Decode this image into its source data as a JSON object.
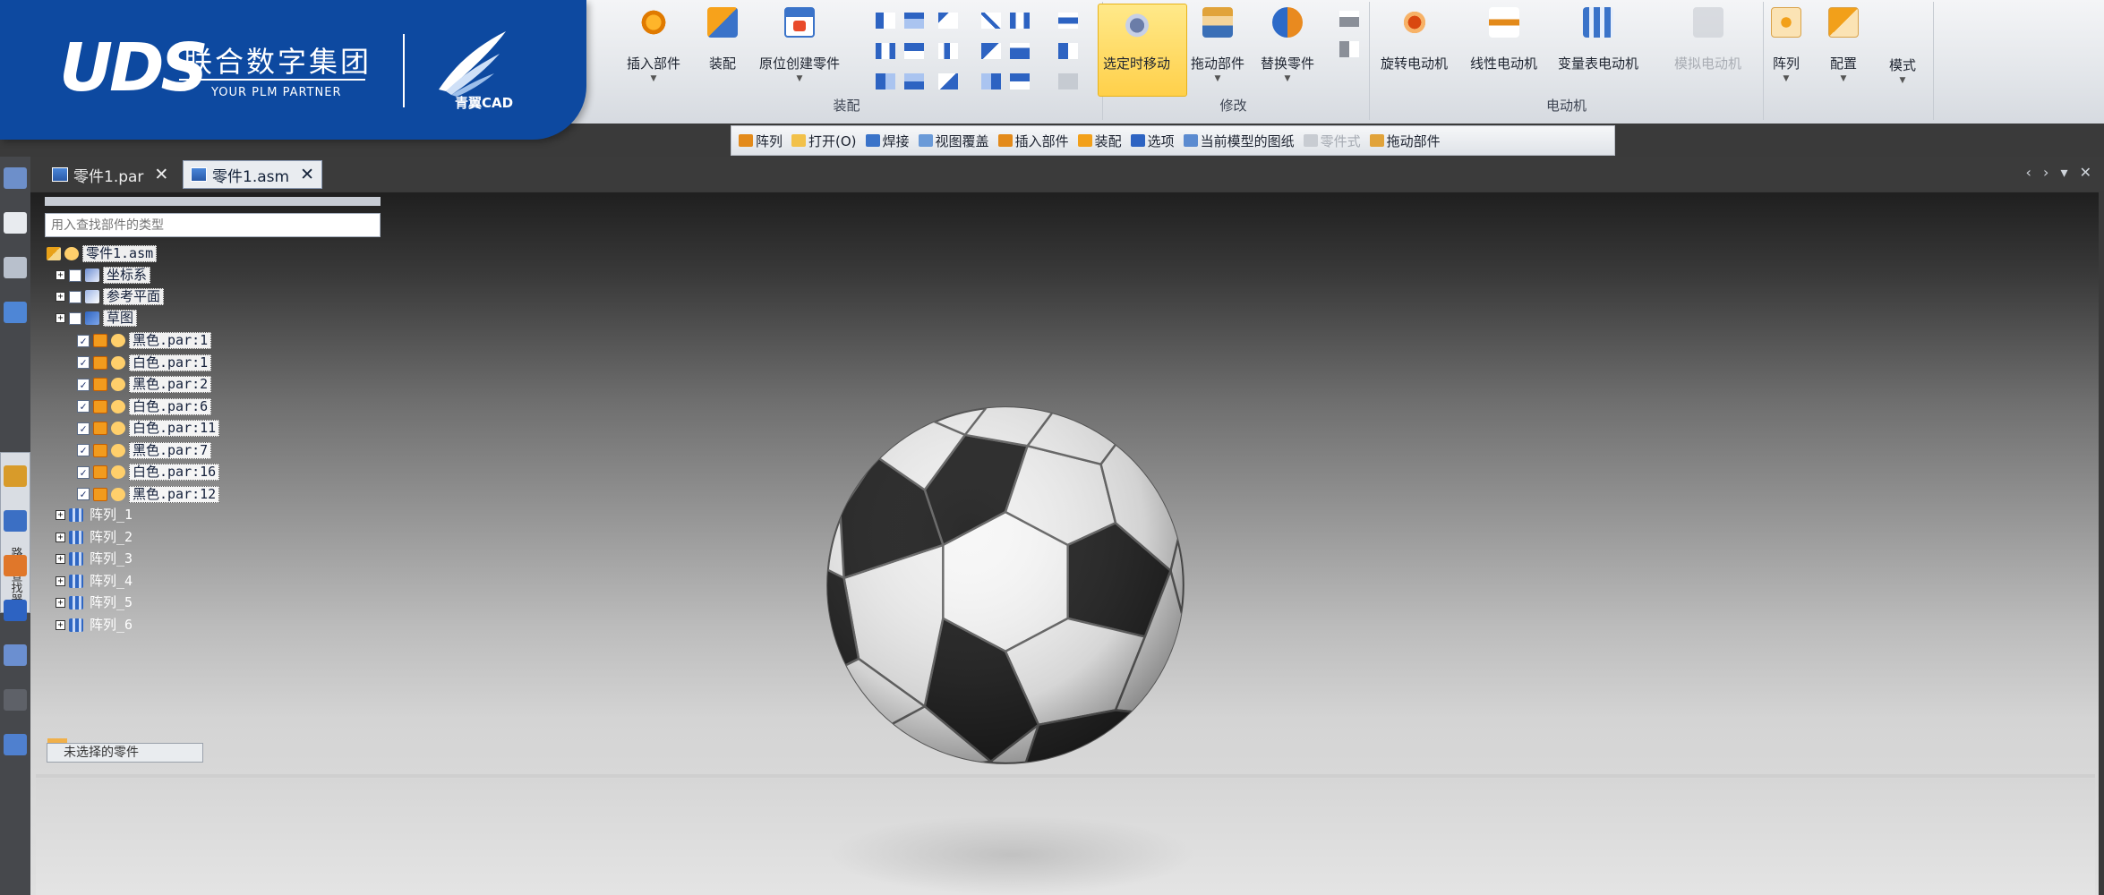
{
  "brand": {
    "logo_text": "UDS",
    "company_cn": "联合数字集团",
    "tagline": "YOUR PLM PARTNER",
    "product": "青翼CAD",
    "primary_color": "#0d49a0"
  },
  "ribbon": {
    "groups": [
      {
        "label": "装配",
        "buttons": [
          "插入部件",
          "装配",
          "原位创建零件"
        ]
      },
      {
        "label": "修改",
        "buttons": [
          "选定时移动",
          "拖动部件",
          "替换零件"
        ]
      },
      {
        "label": "电动机",
        "buttons": [
          "旋转电动机",
          "线性电动机",
          "变量表电动机",
          "模拟电动机"
        ]
      },
      {
        "label": "",
        "buttons": [
          "阵列",
          "配置",
          "模式"
        ]
      }
    ],
    "active_button": "选定时移动"
  },
  "quick_toolbar": {
    "items": [
      "阵列",
      "打开(O)",
      "焊接",
      "视图覆盖",
      "插入部件",
      "装配",
      "选项",
      "当前模型的图纸",
      "零件式",
      "拖动部件"
    ]
  },
  "tabs": [
    {
      "label": "零件1.par",
      "active": false
    },
    {
      "label": "零件1.asm",
      "active": true
    }
  ],
  "tree": {
    "search_placeholder": "用入查找部件的类型",
    "root": "零件1.asm",
    "nodes": [
      "坐标系",
      "参考平面",
      "草图"
    ],
    "parts": [
      "黑色.par:1",
      "白色.par:1",
      "黑色.par:2",
      "白色.par:6",
      "白色.par:11",
      "黑色.par:7",
      "白色.par:16",
      "黑色.par:12"
    ],
    "patterns": [
      "阵列_1",
      "阵列_2",
      "阵列_3",
      "阵列_4",
      "阵列_5",
      "阵列_6"
    ],
    "unselected_label": "未选择的零件"
  },
  "side_panel_label": "路径查找器"
}
